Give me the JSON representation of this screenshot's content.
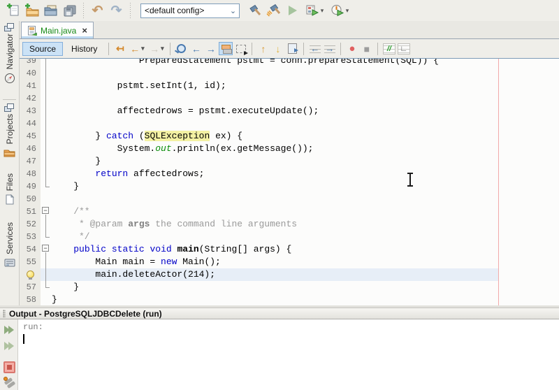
{
  "main_toolbar": {
    "config_value": "<default config>",
    "icons": [
      "new-file",
      "new-project",
      "open-project",
      "save-all",
      "undo",
      "redo",
      "build-project",
      "clean-and-build-project",
      "run-project",
      "debug-project",
      "profile-project"
    ]
  },
  "tab": {
    "label": "Main.java"
  },
  "editor_toolbar": {
    "source_label": "Source",
    "history_label": "History",
    "icons": [
      "jump-to-last-edit",
      "back",
      "forward",
      "find-selection",
      "previous-occurrence",
      "next-occurrence",
      "toggle-highlight-search",
      "toggle-rectangular-selection",
      "previous-bookmark",
      "next-bookmark",
      "toggle-bookmark",
      "shift-line-left",
      "shift-line-right",
      "start-macro-recording",
      "stop-macro-recording",
      "comment",
      "uncomment"
    ]
  },
  "sidebar": {
    "items": [
      {
        "label": "Navigator",
        "icon": "compass-icon"
      },
      {
        "label": "Projects",
        "icon": "folder-icon"
      },
      {
        "label": "Files",
        "icon": "file-icon"
      },
      {
        "label": "Services",
        "icon": "services-icon"
      }
    ]
  },
  "editor": {
    "current_line_number": 56,
    "lines": [
      {
        "num": "39",
        "fold": "line",
        "seg": [
          [
            "p",
            "                PreparedStatement pstmt = conn.prepareStatement(SQL)) {"
          ]
        ]
      },
      {
        "num": "40",
        "fold": "line",
        "seg": []
      },
      {
        "num": "41",
        "fold": "line",
        "seg": [
          [
            "p",
            "            pstmt.setInt(1, id);"
          ]
        ]
      },
      {
        "num": "42",
        "fold": "line",
        "seg": []
      },
      {
        "num": "43",
        "fold": "line",
        "seg": [
          [
            "p",
            "            affectedrows = pstmt.executeUpdate();"
          ]
        ]
      },
      {
        "num": "44",
        "fold": "line",
        "seg": []
      },
      {
        "num": "45",
        "fold": "line",
        "seg": [
          [
            "p",
            "        } "
          ],
          [
            "k",
            "catch"
          ],
          [
            "p",
            " ("
          ],
          [
            "hl",
            "SQLException"
          ],
          [
            "p",
            " ex) {"
          ]
        ]
      },
      {
        "num": "46",
        "fold": "line",
        "seg": [
          [
            "p",
            "            System."
          ],
          [
            "f",
            "out"
          ],
          [
            "p",
            ".println(ex.getMessage());"
          ]
        ]
      },
      {
        "num": "47",
        "fold": "line",
        "seg": [
          [
            "p",
            "        }"
          ]
        ]
      },
      {
        "num": "48",
        "fold": "line",
        "seg": [
          [
            "p",
            "        "
          ],
          [
            "k",
            "return"
          ],
          [
            "p",
            " affectedrows;"
          ]
        ]
      },
      {
        "num": "49",
        "fold": "end",
        "seg": [
          [
            "p",
            "    }"
          ]
        ]
      },
      {
        "num": "50",
        "fold": "",
        "seg": []
      },
      {
        "num": "51",
        "fold": "box",
        "seg": [
          [
            "c",
            "    /**"
          ]
        ]
      },
      {
        "num": "52",
        "fold": "line",
        "seg": [
          [
            "c",
            "     * @param "
          ],
          [
            "cb",
            "args"
          ],
          [
            "c",
            " the command line arguments"
          ]
        ]
      },
      {
        "num": "53",
        "fold": "end",
        "seg": [
          [
            "c",
            "     */"
          ]
        ]
      },
      {
        "num": "54",
        "fold": "box",
        "seg": [
          [
            "p",
            "    "
          ],
          [
            "k",
            "public"
          ],
          [
            "p",
            " "
          ],
          [
            "k",
            "static"
          ],
          [
            "p",
            " "
          ],
          [
            "k",
            "void"
          ],
          [
            "p",
            " "
          ],
          [
            "b",
            "main"
          ],
          [
            "p",
            "(String[] args) {"
          ]
        ]
      },
      {
        "num": "55",
        "fold": "line",
        "seg": [
          [
            "p",
            "        Main main = "
          ],
          [
            "k",
            "new"
          ],
          [
            "p",
            " Main();"
          ]
        ]
      },
      {
        "num": "56",
        "fold": "line",
        "bulb": true,
        "current": true,
        "seg": [
          [
            "p",
            "        main.deleteActor(214);"
          ]
        ]
      },
      {
        "num": "57",
        "fold": "end",
        "seg": [
          [
            "p",
            "    }"
          ]
        ]
      },
      {
        "num": "58",
        "fold": "",
        "seg": [
          [
            "p",
            "}"
          ]
        ]
      }
    ]
  },
  "output": {
    "title": "Output - PostgreSQLJDBCDelete (run)",
    "first_line": "run:",
    "icons": [
      "rerun",
      "rerun-with-different-parameters",
      "stop-build",
      "ant-settings"
    ]
  },
  "colors": {
    "keyword": "#0000C8",
    "comment": "#9A9A9A",
    "static_field": "#098C09",
    "occurrence_highlight": "#F3F1A3",
    "current_line": "#E7EEF7",
    "margin_line": "#F2AAAA",
    "tab_label": "#168A16",
    "selected_toggle_bg": "#CBE2F6"
  }
}
